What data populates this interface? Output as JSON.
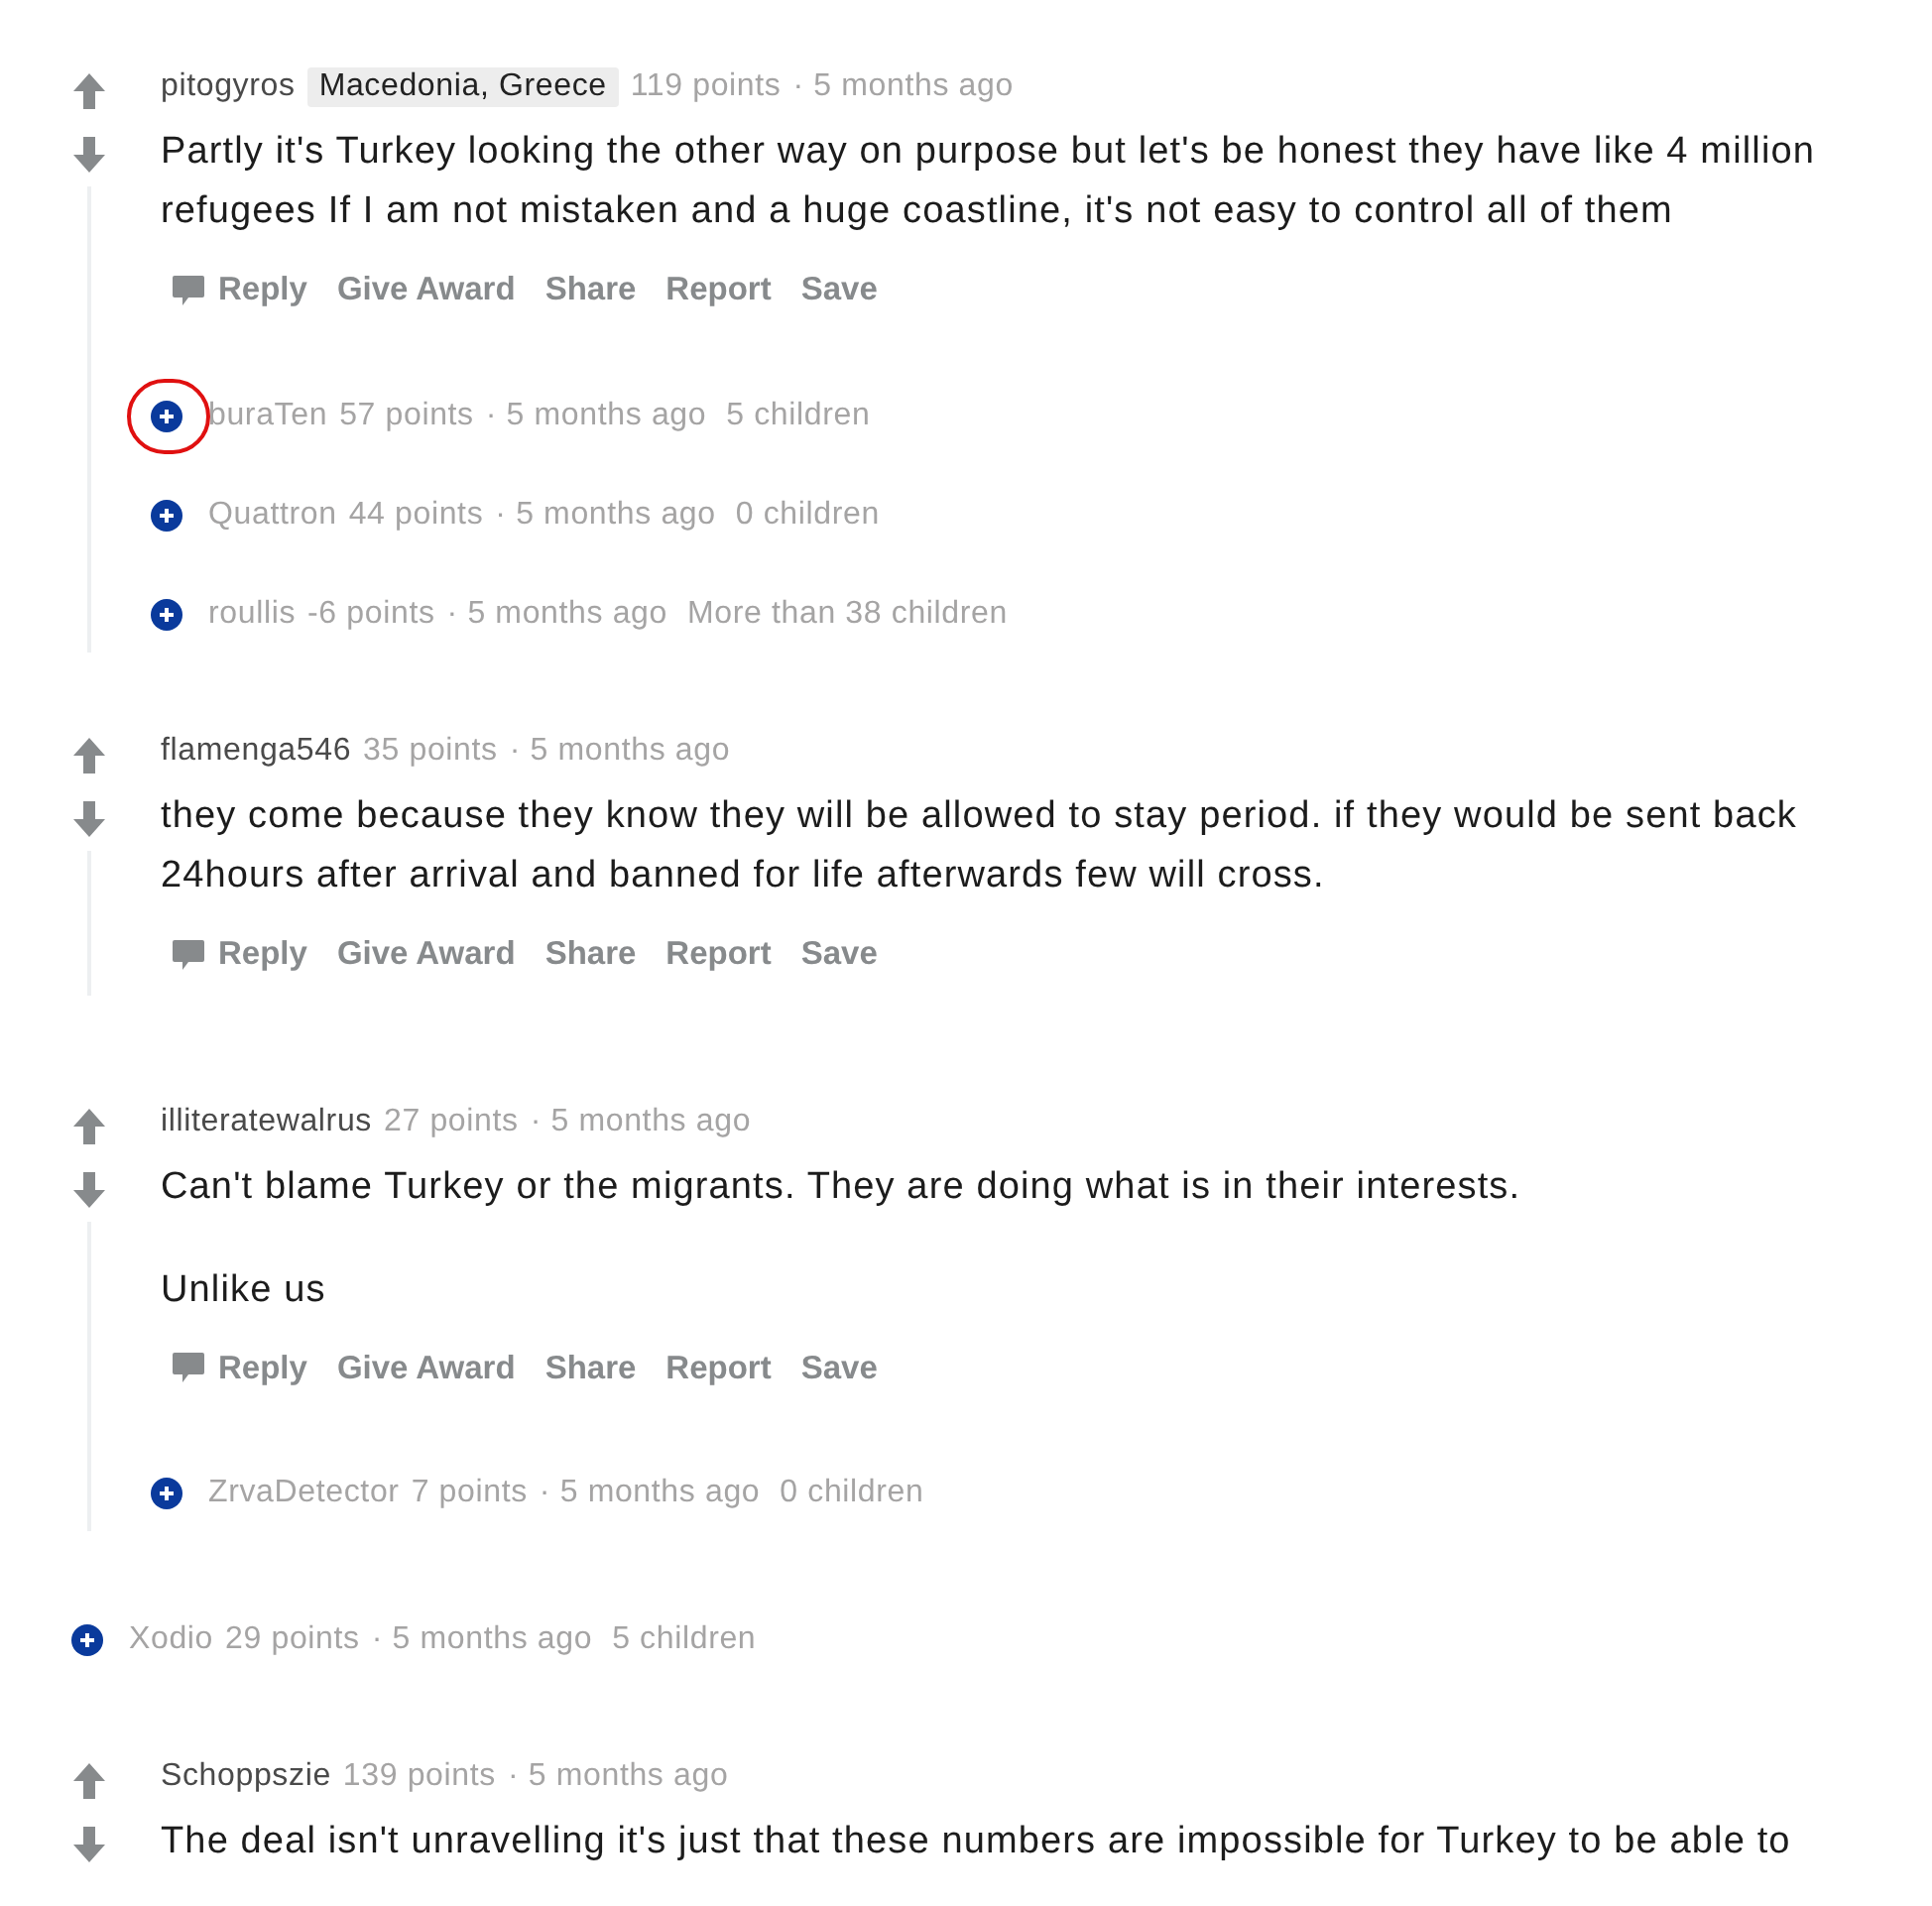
{
  "comments": [
    {
      "kind": "expanded",
      "author": "pitogyros",
      "flair": "Macedonia, Greece",
      "points": "119 points",
      "time": "· 5 months ago",
      "paragraphs": [
        "Partly it's Turkey looking the other way on purpose but let's be honest they have like 4 million refugees If I am not mistaken and a huge coastline, it's not easy to control all of them"
      ],
      "actions": [
        "Reply",
        "Give Award",
        "Share",
        "Report",
        "Save"
      ],
      "children": [
        {
          "kind": "collapsed",
          "author": "buraTen",
          "points": "57 points",
          "time": "· 5 months ago",
          "count": "5 children",
          "circled": true
        },
        {
          "kind": "collapsed",
          "author": "Quattron",
          "points": "44 points",
          "time": "· 5 months ago",
          "count": "0 children",
          "circled": false
        },
        {
          "kind": "collapsed",
          "author": "roullis",
          "points": "-6 points",
          "time": "· 5 months ago",
          "count": "More than 38 children",
          "circled": false
        }
      ]
    },
    {
      "kind": "expanded",
      "author": "flamenga546",
      "points": "35 points",
      "time": "· 5 months ago",
      "paragraphs": [
        "they come because they know they will be allowed to stay period. if they would be sent back 24hours after arrival and banned for life afterwards few will cross."
      ],
      "actions": [
        "Reply",
        "Give Award",
        "Share",
        "Report",
        "Save"
      ]
    },
    {
      "kind": "expanded",
      "author": "illiteratewalrus",
      "points": "27 points",
      "time": "· 5 months ago",
      "paragraphs": [
        "Can't blame Turkey or the migrants. They are doing what is in their interests.",
        "Unlike us"
      ],
      "actions": [
        "Reply",
        "Give Award",
        "Share",
        "Report",
        "Save"
      ],
      "children": [
        {
          "kind": "collapsed",
          "author": "ZrvaDetector",
          "points": "7 points",
          "time": "· 5 months ago",
          "count": "0 children",
          "circled": false
        }
      ]
    },
    {
      "kind": "collapsed",
      "author": "Xodio",
      "points": "29 points",
      "time": "· 5 months ago",
      "count": "5 children",
      "circled": false
    },
    {
      "kind": "cut",
      "author": "Schoppszie",
      "points": "139 points",
      "time": "· 5 months ago",
      "paragraphs": [
        "The deal isn't unravelling it's just that these numbers are impossible for Turkey to be able to"
      ]
    }
  ]
}
